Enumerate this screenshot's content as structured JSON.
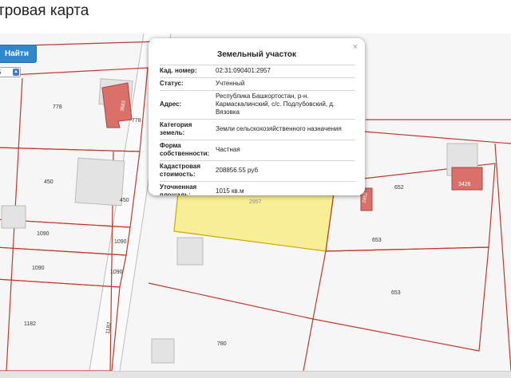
{
  "page": {
    "title": "тровая карта"
  },
  "controls": {
    "find_button_label": "Найти",
    "select_value": "5"
  },
  "popup": {
    "title": "Земельный участок",
    "close_symbol": "×",
    "rows": [
      {
        "key": "Кад. номер:",
        "value": "02:31:090401:2957"
      },
      {
        "key": "Статус:",
        "value": "Учтенный"
      },
      {
        "key": "Адрес:",
        "value": "Республика Башкортостан, р-н. Кармаскалинский, с/с. Подлубовский, д. Вязовка"
      },
      {
        "key": "Категория земель:",
        "value": "Земли сельскохозяйственного назначения"
      },
      {
        "key": "Форма собственности:",
        "value": "Частная"
      },
      {
        "key": "Кадастровая стоимость:",
        "value": "208856.55 руб"
      },
      {
        "key": "Уточненная площадь:",
        "value": "1015 кв.м"
      }
    ]
  },
  "map": {
    "parcel_labels": {
      "p778": "778",
      "p778b": "778",
      "p450": "450",
      "p450b": "450",
      "p1090a": "1090",
      "p1090b": "1090",
      "p1090c": "1090",
      "p1090d": "1090",
      "p1182a": "1182",
      "p1182b": "1182",
      "p780": "780",
      "p652": "652",
      "p653a": "653",
      "p653b": "653",
      "p2957": "2957"
    },
    "building_labels": {
      "b3683": "3683",
      "b3426": "3426",
      "b2452": "2452"
    },
    "colors": {
      "boundary": "#c0392b",
      "selected_fill": "#f8ee96",
      "building_red": "#d9716a",
      "building_gray": "#e3e3e3"
    }
  }
}
